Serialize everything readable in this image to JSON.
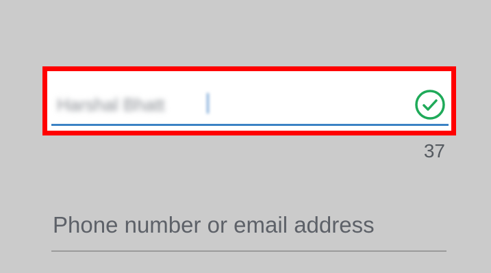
{
  "name_field": {
    "value": "Harshal Bhatt",
    "valid_icon": "check-circle-icon"
  },
  "char_counter": "37",
  "contact_field": {
    "placeholder": "Phone number or email address"
  },
  "colors": {
    "highlight": "#ff0000",
    "valid": "#1faa59",
    "underline_active": "#3b82c4",
    "background": "#cbcbcb"
  }
}
